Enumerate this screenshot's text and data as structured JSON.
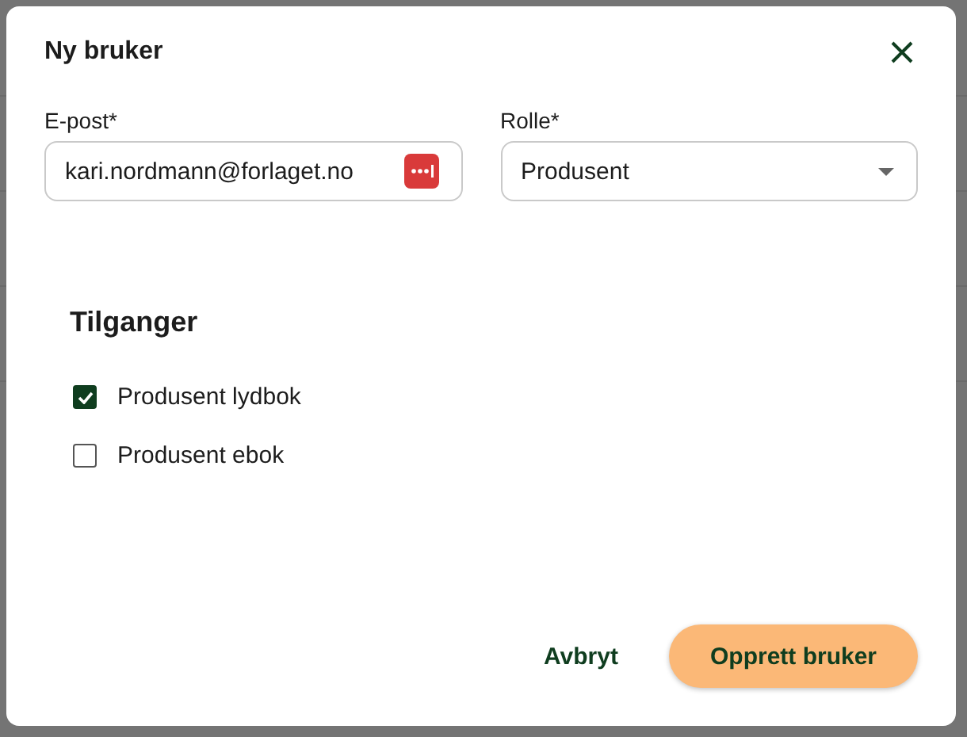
{
  "dialog": {
    "title": "Ny bruker",
    "fields": [
      {
        "kind": "text",
        "label": "E-post*",
        "value": "kari.nordmann@forlaget.no"
      },
      {
        "kind": "select",
        "label": "Rolle*",
        "value": "Produsent"
      }
    ],
    "section_title": "Tilganger",
    "permissions": [
      {
        "label": "Produsent lydbok",
        "checked": true
      },
      {
        "label": "Produsent ebok",
        "checked": false
      }
    ],
    "buttons": [
      {
        "kind": "text",
        "label": "Avbryt"
      },
      {
        "kind": "primary",
        "label": "Opprett bruker"
      }
    ]
  }
}
